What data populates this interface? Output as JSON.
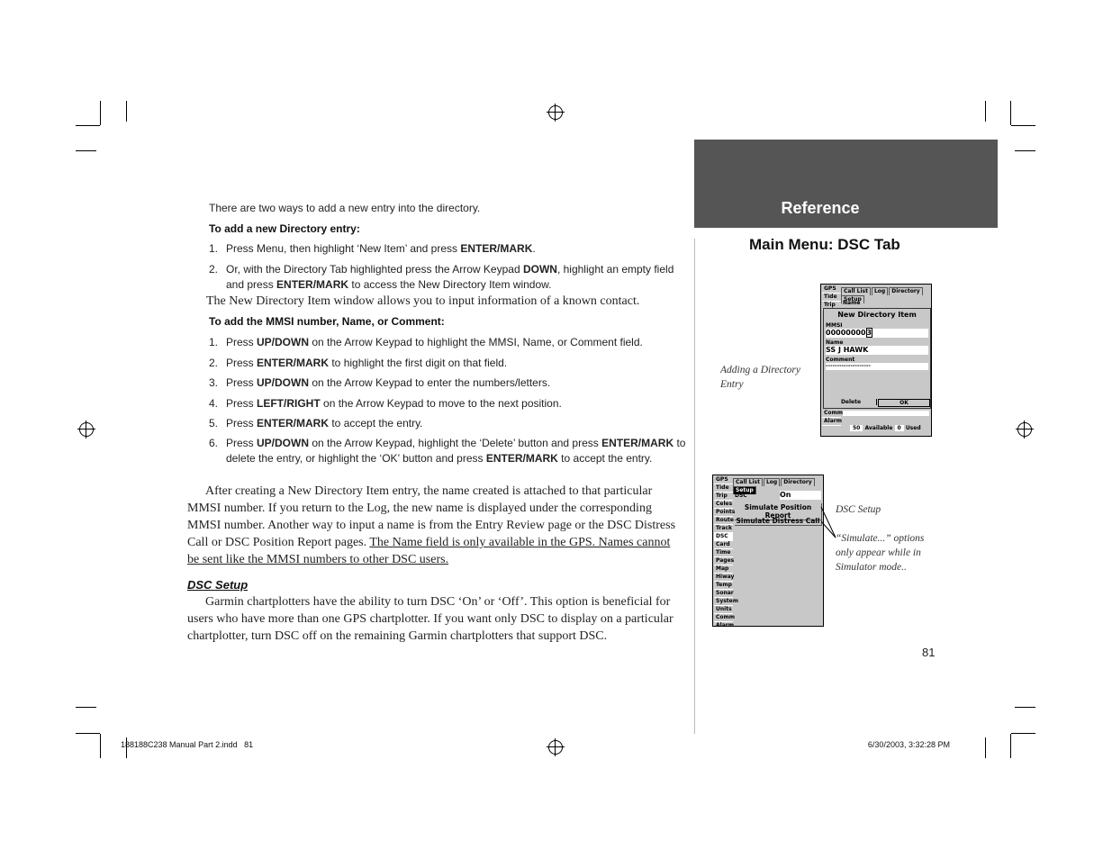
{
  "header": {
    "section": "Reference",
    "title": "Main Menu: DSC Tab"
  },
  "intro": "There are two ways to add a new entry into the directory.",
  "entry_heading": "To add a new Directory entry:",
  "entry_steps": [
    {
      "n": "1.",
      "parts": [
        "Press Menu, then highlight ‘New Item’ and press ",
        "ENTER/MARK",
        "."
      ]
    },
    {
      "n": "2.",
      "parts": [
        "Or, with the Directory Tab highlighted press the Arrow Keypad ",
        "DOWN",
        ", highlight an empty field and press ",
        "ENTER/MARK",
        " to access the New Directory Item window."
      ]
    }
  ],
  "window_note": "The New Directory Item window allows you to input information of a known contact.",
  "mmsi_heading": "To add the MMSI number, Name, or Comment:",
  "mmsi_steps": [
    {
      "n": "1.",
      "parts": [
        "Press ",
        "UP/DOWN",
        " on the Arrow Keypad to highlight the MMSI, Name, or Comment field."
      ]
    },
    {
      "n": "2.",
      "parts": [
        "Press ",
        "ENTER/MARK",
        " to highlight the first digit on that field."
      ]
    },
    {
      "n": "3.",
      "parts": [
        "Press ",
        "UP/DOWN",
        " on the Arrow Keypad to enter the numbers/letters."
      ]
    },
    {
      "n": "4.",
      "parts": [
        "Press ",
        "LEFT/RIGHT",
        " on the Arrow Keypad to move to the next position."
      ]
    },
    {
      "n": "5.",
      "parts": [
        "Press ",
        "ENTER/MARK",
        " to accept the entry."
      ]
    },
    {
      "n": "6.",
      "parts": [
        "Press ",
        "UP/DOWN",
        " on the Arrow Keypad, highlight the ‘Delete’ button and press ",
        "ENTER/MARK",
        " to delete the entry, or highlight the ‘OK’ button and press ",
        "ENTER/MARK",
        " to accept the entry."
      ]
    }
  ],
  "para1": "After creating a New Directory Item entry, the name created is attached to that particular MMSI number. If you return to the Log, the new name is displayed under the corresponding MMSI number. Another way to input a name is from the Entry Review page or the DSC Distress Call or DSC Position Report pages. ",
  "para1_underlined": "The Name field is only available in the GPS. Names cannot be sent like the MMSI numbers to other DSC users.",
  "dsc_heading": "DSC Setup",
  "para2": "Garmin chartplotters have the ability to turn DSC ‘On’ or ‘Off’. This option is beneficial for users who have more than one GPS chartplotter. If you want only DSC to display on a particular chartplotter, turn DSC off on the remaining Garmin chartplotters that support DSC.",
  "screen1": {
    "side": [
      "GPS",
      "Tide",
      "Trip"
    ],
    "side_bottom": [
      "Comm",
      "Alarm"
    ],
    "tabs": [
      "Call List",
      "Log",
      "Directory",
      "Setup"
    ],
    "col": "Name",
    "dialog_title": "New Directory Item",
    "mmsi_label": "MMSI",
    "mmsi_value": "00000000",
    "mmsi_cursor": "3",
    "name_label": "Name",
    "name_value": "SS J HAWK",
    "comment_label": "Comment",
    "comment_value": "--------------------",
    "delete": "Delete",
    "ok": "OK",
    "available_count": "50",
    "available": "Available",
    "used_count": "0",
    "used": "Used"
  },
  "screen1_caption": "Adding a Directory Entry",
  "screen2": {
    "side": [
      "GPS",
      "Tide",
      "Trip",
      "Celes",
      "Points",
      "Route",
      "Track",
      "DSC",
      "Card",
      "Time",
      "Pages",
      "Map",
      "Hiway",
      "Temp",
      "Sonar",
      "System",
      "Units",
      "Comm",
      "Alarm"
    ],
    "tabs": [
      "Call List",
      "Log",
      "Directory",
      "Setup"
    ],
    "dsc_label": "DSC",
    "dsc_value": "On",
    "sim_position": "Simulate Position Report",
    "sim_distress": "Simulate Distress Call"
  },
  "screen2_caption": "DSC Setup",
  "screen2_note": "“Simulate...” options only appear while in Simulator mode..",
  "page_number": "81",
  "footer": {
    "file": "188188C238 Manual Part 2.indd   81",
    "date": "6/30/2003, 3:32:28 PM"
  },
  "colors": {
    "header_bg": "#555555",
    "screen_bg": "#c8c8c8"
  }
}
